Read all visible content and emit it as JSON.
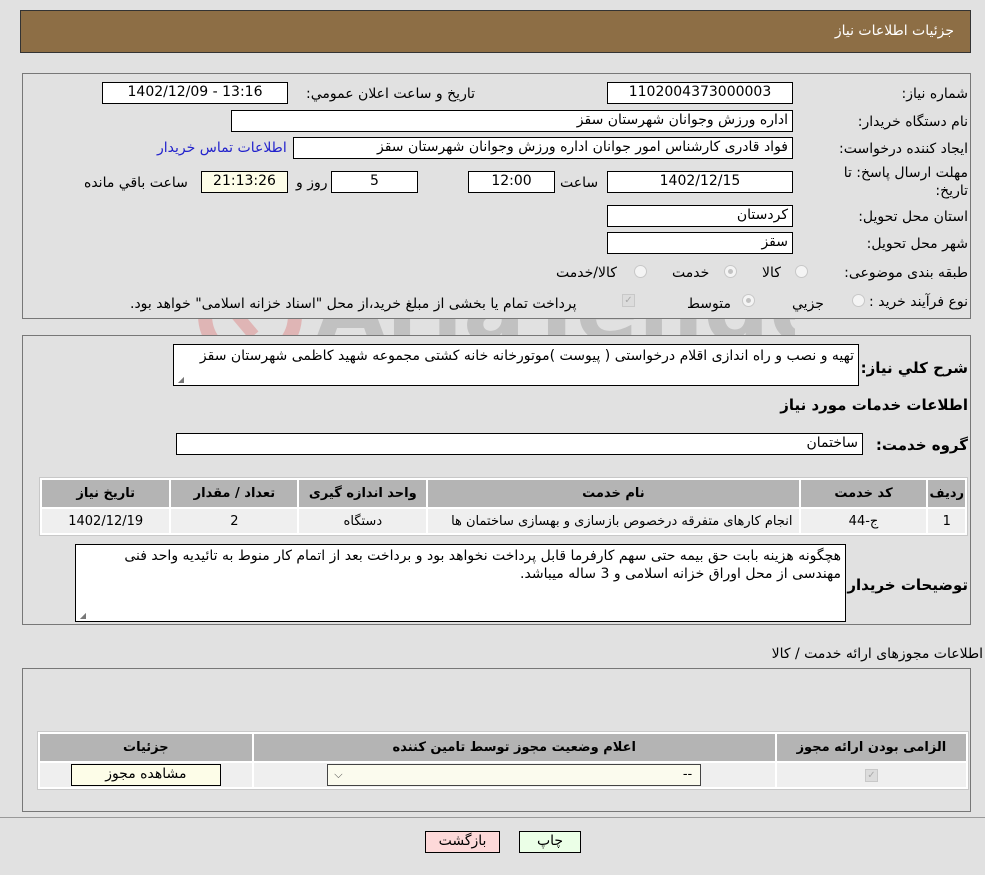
{
  "header": {
    "title": "جزئیات اطلاعات نیاز"
  },
  "need_info": {
    "need_number_label": "شماره نیاز:",
    "need_number": "1102004373000003",
    "announce_label": "تاریخ و ساعت اعلان عمومي:",
    "announce_value": "1402/12/09 - 13:16",
    "buyer_org_label": "نام دستگاه خريدار:",
    "buyer_org": "اداره ورزش وجوانان شهرستان سقز",
    "creator_label": "ايجاد كننده درخواست:",
    "creator": "فواد قادری کارشناس امور جوانان اداره ورزش وجوانان شهرستان سقز",
    "contact_link": "اطلاعات تماس خريدار",
    "deadline_label": "مهلت ارسال پاسخ: تا تاريخ:",
    "deadline_date": "1402/12/15",
    "time_label": "ساعت",
    "deadline_time": "12:00",
    "days_value": "5",
    "days_label": "روز و",
    "remaining_time": "21:13:26",
    "remaining_label": "ساعت باقي مانده",
    "province_label": "استان محل تحويل:",
    "province": "کردستان",
    "city_label": "شهر محل تحويل:",
    "city": "سقز",
    "category_label": "طبقه بندی موضوعی:",
    "category_options": [
      {
        "label": "کالا",
        "checked": false
      },
      {
        "label": "خدمت",
        "checked": true
      },
      {
        "label": "کالا/خدمت",
        "checked": false
      }
    ],
    "process_label": "نوع فرآيند خريد :",
    "process_options": [
      {
        "label": "جزيي",
        "checked": false
      },
      {
        "label": "متوسط",
        "checked": true
      }
    ],
    "treasury_note": "پرداخت تمام یا بخشی از مبلغ خرید،از محل \"اسناد خزانه اسلامی\" خواهد بود.",
    "treasury_checked": true
  },
  "services": {
    "description_label": "شرح کلي نياز:",
    "description": "تهیه و نصب و راه اندازی اقلام درخواستی ( پیوست )موتورخانه خانه کشتی مجموعه شهید کاظمی شهرستان سقز",
    "section_title": "اطلاعات خدمات مورد نياز",
    "group_label": "گروه خدمت:",
    "group_value": "ساختمان",
    "table": {
      "headers": [
        "رديف",
        "کد خدمت",
        "نام خدمت",
        "واحد اندازه گيری",
        "تعداد / مقدار",
        "تاريخ نياز"
      ],
      "rows": [
        [
          "1",
          "ج-44",
          "انجام کارهای متفرقه درخصوص بازسازی و بهسازی ساختمان ها",
          "دستگاه",
          "2",
          "1402/12/19"
        ]
      ]
    },
    "buyer_notes_label": "توضيحات خريدار:",
    "buyer_notes": "هچگونه هزینه بابت حق بیمه حتی سهم کارفرما قابل پرداخت نخواهد بود و برداخت بعد از اتمام کار منوط به  تائیدیه واحد فنی مهندسی از محل اوراق خزانه اسلامی و 3 ساله میباشد."
  },
  "permits": {
    "section_title": "اطلاعات مجوزهای ارائه خدمت / کالا",
    "table": {
      "headers": [
        "الزامی بودن ارائه مجوز",
        "اعلام وضعیت مجوز توسط تامین کننده",
        "جزئیات"
      ],
      "rows": [
        {
          "required_checked": true,
          "status_value": "--",
          "details_button": "مشاهده مجوز"
        }
      ]
    }
  },
  "footer": {
    "print_label": "چاپ",
    "back_label": "بازگشت"
  },
  "watermark": {
    "text": "AriaTender.neT"
  }
}
